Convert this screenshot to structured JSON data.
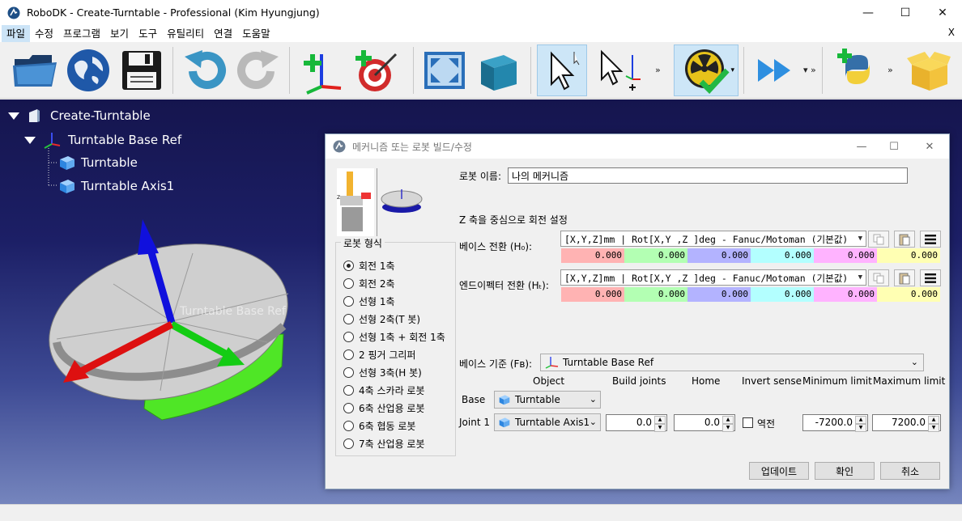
{
  "window": {
    "title": "RoboDK - Create-Turntable - Professional (Kim Hyungjung)",
    "minimize": "—",
    "maximize": "☐",
    "close": "✕"
  },
  "menu": {
    "items": [
      "파일",
      "수정",
      "프로그램",
      "보기",
      "도구",
      "유틸리티",
      "연결",
      "도움말"
    ],
    "close": "X"
  },
  "toolbar": {
    "buttons": [
      "open-folder",
      "online-library",
      "save",
      "undo",
      "redo",
      "add-reference-frame",
      "add-target",
      "fit-all",
      "iso-view",
      "select",
      "move-reference",
      "check-collisions",
      "run-program",
      "add-python-program",
      "package"
    ],
    "more": "»"
  },
  "tree": {
    "station": "Create-Turntable",
    "base_ref": "Turntable Base Ref",
    "items": [
      "Turntable",
      "Turntable Axis1"
    ]
  },
  "scene": {
    "overlay_label": "Turntable Base Ref"
  },
  "dialog": {
    "title": "메커니즘 또는 로봇 빌드/수정",
    "robot_name_label": "로봇 이름:",
    "robot_name_value": "나의 메커니즘",
    "rotation_note": "Z 축을 중심으로 회전 설정",
    "base_transform_label": "베이스 전환 (H₀):",
    "tool_transform_label": "엔드이펙터 전환 (Hₜ):",
    "format_combo": "[X,Y,Z]mm | Rot[X,Y ,Z  ]deg - Fanuc/Motoman (기본값)",
    "base_values": [
      "0.000",
      "0.000",
      "0.000",
      "0.000",
      "0.000",
      "0.000"
    ],
    "tool_values": [
      "0.000",
      "0.000",
      "0.000",
      "0.000",
      "0.000",
      "0.000"
    ],
    "value_colors": [
      "#ffb3b3",
      "#b3ffb3",
      "#b3b3ff",
      "#b3ffff",
      "#ffb3ff",
      "#ffffb3"
    ],
    "robot_type_title": "로봇 형식",
    "robot_types": [
      "회전 1축",
      "회전 2축",
      "선형 1축",
      "선형 2축(T 봇)",
      "선형 1축 + 회전 1축",
      "2 핑거 그리퍼",
      "선형 3축(H 봇)",
      "4축 스카라 로봇",
      "6축 산업용 로봇",
      "6축 협동 로봇",
      "7축 산업용 로봇"
    ],
    "selected_type": "회전 1축",
    "base_frame_label": "베이스 기준 (Fʙ):",
    "base_frame_value": "Turntable Base Ref",
    "columns": {
      "object": "Object",
      "build_joints": "Build joints",
      "home": "Home",
      "invert": "Invert sense",
      "min": "Minimum limit",
      "max": "Maximum limit"
    },
    "base_row": {
      "label": "Base",
      "object": "Turntable"
    },
    "joint_row": {
      "label": "Joint 1",
      "object": "Turntable Axis1",
      "build": "0.0",
      "home": "0.0",
      "invert_label": "역전",
      "min": "-7200.0",
      "max": "7200.0"
    },
    "buttons": {
      "update": "업데이트",
      "ok": "확인",
      "cancel": "취소"
    }
  }
}
